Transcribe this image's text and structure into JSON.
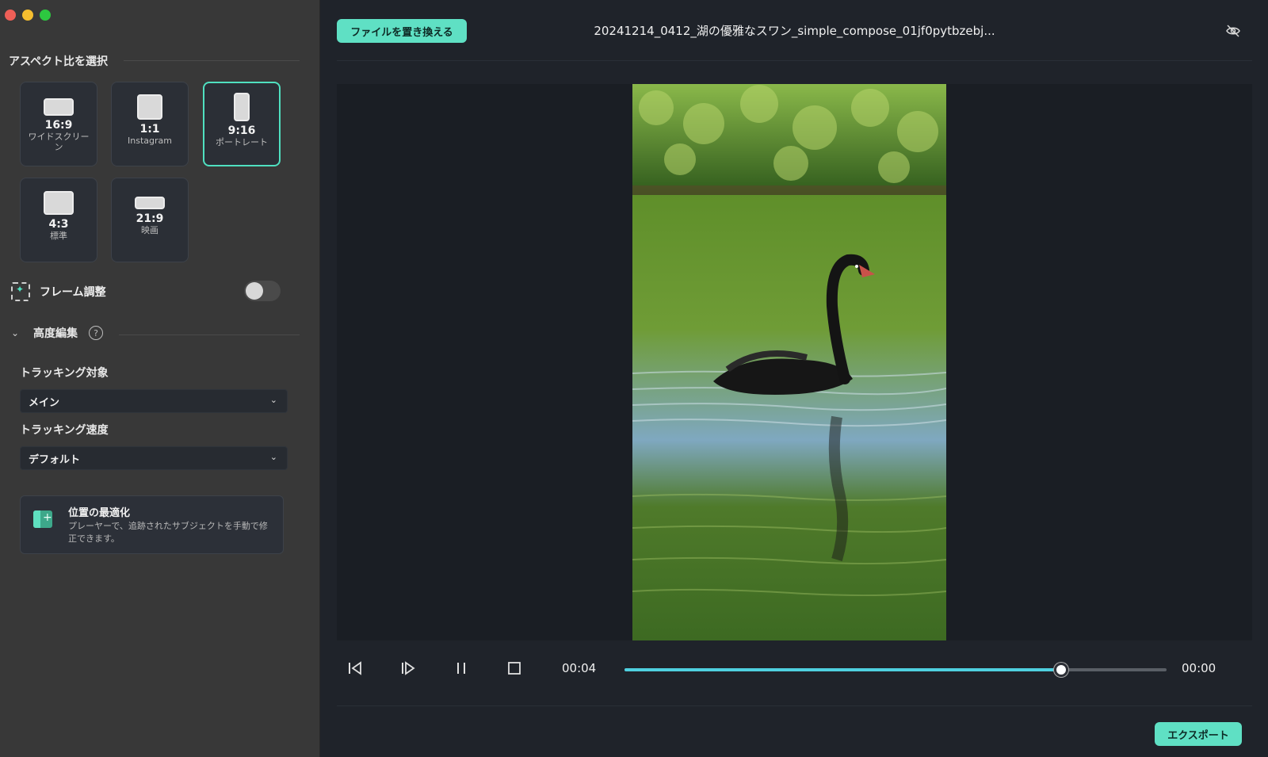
{
  "sidebar": {
    "section_title": "アスペクト比を選択",
    "ratios": [
      {
        "ratio": "16:9",
        "sub": "ワイドスクリーン"
      },
      {
        "ratio": "1:1",
        "sub": "Instagram"
      },
      {
        "ratio": "9:16",
        "sub": "ポートレート"
      },
      {
        "ratio": "4:3",
        "sub": "標準"
      },
      {
        "ratio": "21:9",
        "sub": "映画"
      }
    ],
    "selected_ratio": "9:16",
    "frame_adjust_label": "フレーム調整",
    "frame_adjust_on": false,
    "advanced_label": "高度編集",
    "help_glyph": "?",
    "tracking_target_label": "トラッキング対象",
    "tracking_target_value": "メイン",
    "tracking_speed_label": "トラッキング速度",
    "tracking_speed_value": "デフォルト",
    "optimize": {
      "title": "位置の最適化",
      "desc": "プレーヤーで、追跡されたサブジェクトを手動で修正できます。"
    }
  },
  "main": {
    "replace_button": "ファイルを置き換える",
    "file_title": "20241214_0412_湖の優雅なスワン_simple_compose_01jf0pytbzebj...",
    "current_time": "00:04",
    "end_time": "00:00",
    "progress": 0.805,
    "export_button": "エクスポート"
  },
  "colors": {
    "accent": "#5fe0c4",
    "progress": "#4fd0e0"
  },
  "icons": [
    "frame-adjust-icon",
    "chevron-down-icon",
    "help-icon",
    "optimize-icon",
    "eye-off-icon",
    "prev-frame-icon",
    "next-frame-icon",
    "pause-icon",
    "stop-icon"
  ]
}
